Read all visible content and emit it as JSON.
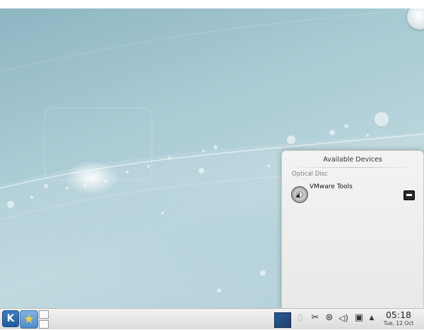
{
  "popup": {
    "title": "Available Devices",
    "section": "Optical Disc",
    "device": {
      "name": "VMware Tools",
      "icon": "optical-disc-icon",
      "action_icon": "eject-icon"
    }
  },
  "panel": {
    "launcher_icon": "kde-logo-icon",
    "launcher_glyph": "K",
    "favorites_glyph": "★",
    "tray_icons": [
      "display-icon",
      "clipboard-icon",
      "scissors-icon",
      "network-icon",
      "volume-icon",
      "device-notifier-icon",
      "expand-arrow-icon"
    ],
    "clock": {
      "time": "05:18",
      "date": "Tue, 12 Oct"
    }
  },
  "colors": {
    "wallpaper": "#a9cbd4",
    "launcher": "#2d6bb0",
    "panel": "#e8e8e6"
  }
}
